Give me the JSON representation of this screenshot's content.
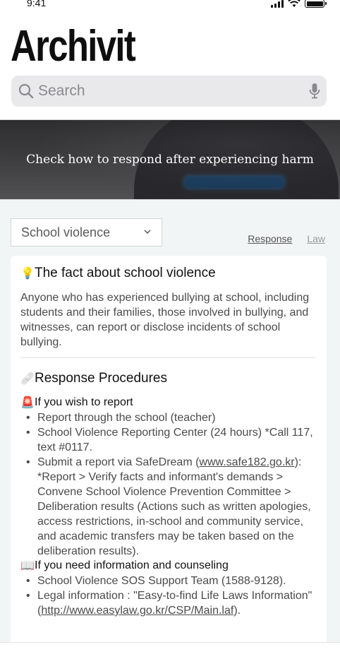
{
  "status_bar": {
    "time": "9:41"
  },
  "app": {
    "title": "Archivit"
  },
  "search": {
    "placeholder": "Search"
  },
  "banner": {
    "text": "Check how to respond after experiencing harm"
  },
  "filter": {
    "selected": "School violence"
  },
  "tabs": [
    {
      "label": "Response"
    },
    {
      "label": "Law"
    }
  ],
  "fact": {
    "emoji": "💡",
    "title": "The fact about school violence",
    "body": "Anyone who has experienced bullying at school, including students and their families, those involved in bullying, and witnesses, can report or disclose incidents of school bullying."
  },
  "procedures": {
    "emoji": "🩹",
    "title": "Response Procedures",
    "report": {
      "emoji": "🚨",
      "heading": "If you wish to report",
      "items": [
        "Report through the school (teacher)",
        "School Violence Reporting Center (24 hours) *Call 117, text #0117.",
        "Submit a report via SafeDream (www.safe182.go.kr): *Report > Verify facts and informant's demands > Convene School Violence Prevention Committee > Deliberation results (Actions such as written apologies, access restrictions, in-school and community service, and academic transfers may be taken based on the deliberation results)."
      ],
      "link_text": "www.safe182.go.kr"
    },
    "info": {
      "emoji": "📖",
      "heading": "If you need information and counseling",
      "items": [
        "School Violence SOS Support Team (1588-9128).",
        "Legal information : \"Easy-to-find Life Laws Information\" (http://www.easylaw.go.kr/CSP/Main.laf)."
      ],
      "link_text": "http://www.easylaw.go.kr/CSP/Main.laf"
    }
  },
  "icons": {
    "search": "search-icon",
    "mic": "microphone-icon",
    "chevron": "chevron-down-icon",
    "signal": "cellular-signal-icon",
    "wifi": "wifi-icon",
    "battery": "battery-icon"
  },
  "colors": {
    "search_bg": "#e9e9eb",
    "content_bg": "#f1f5f6",
    "card_bg": "#ffffff",
    "text_primary": "#111111",
    "text_secondary": "#4a4a4a"
  }
}
